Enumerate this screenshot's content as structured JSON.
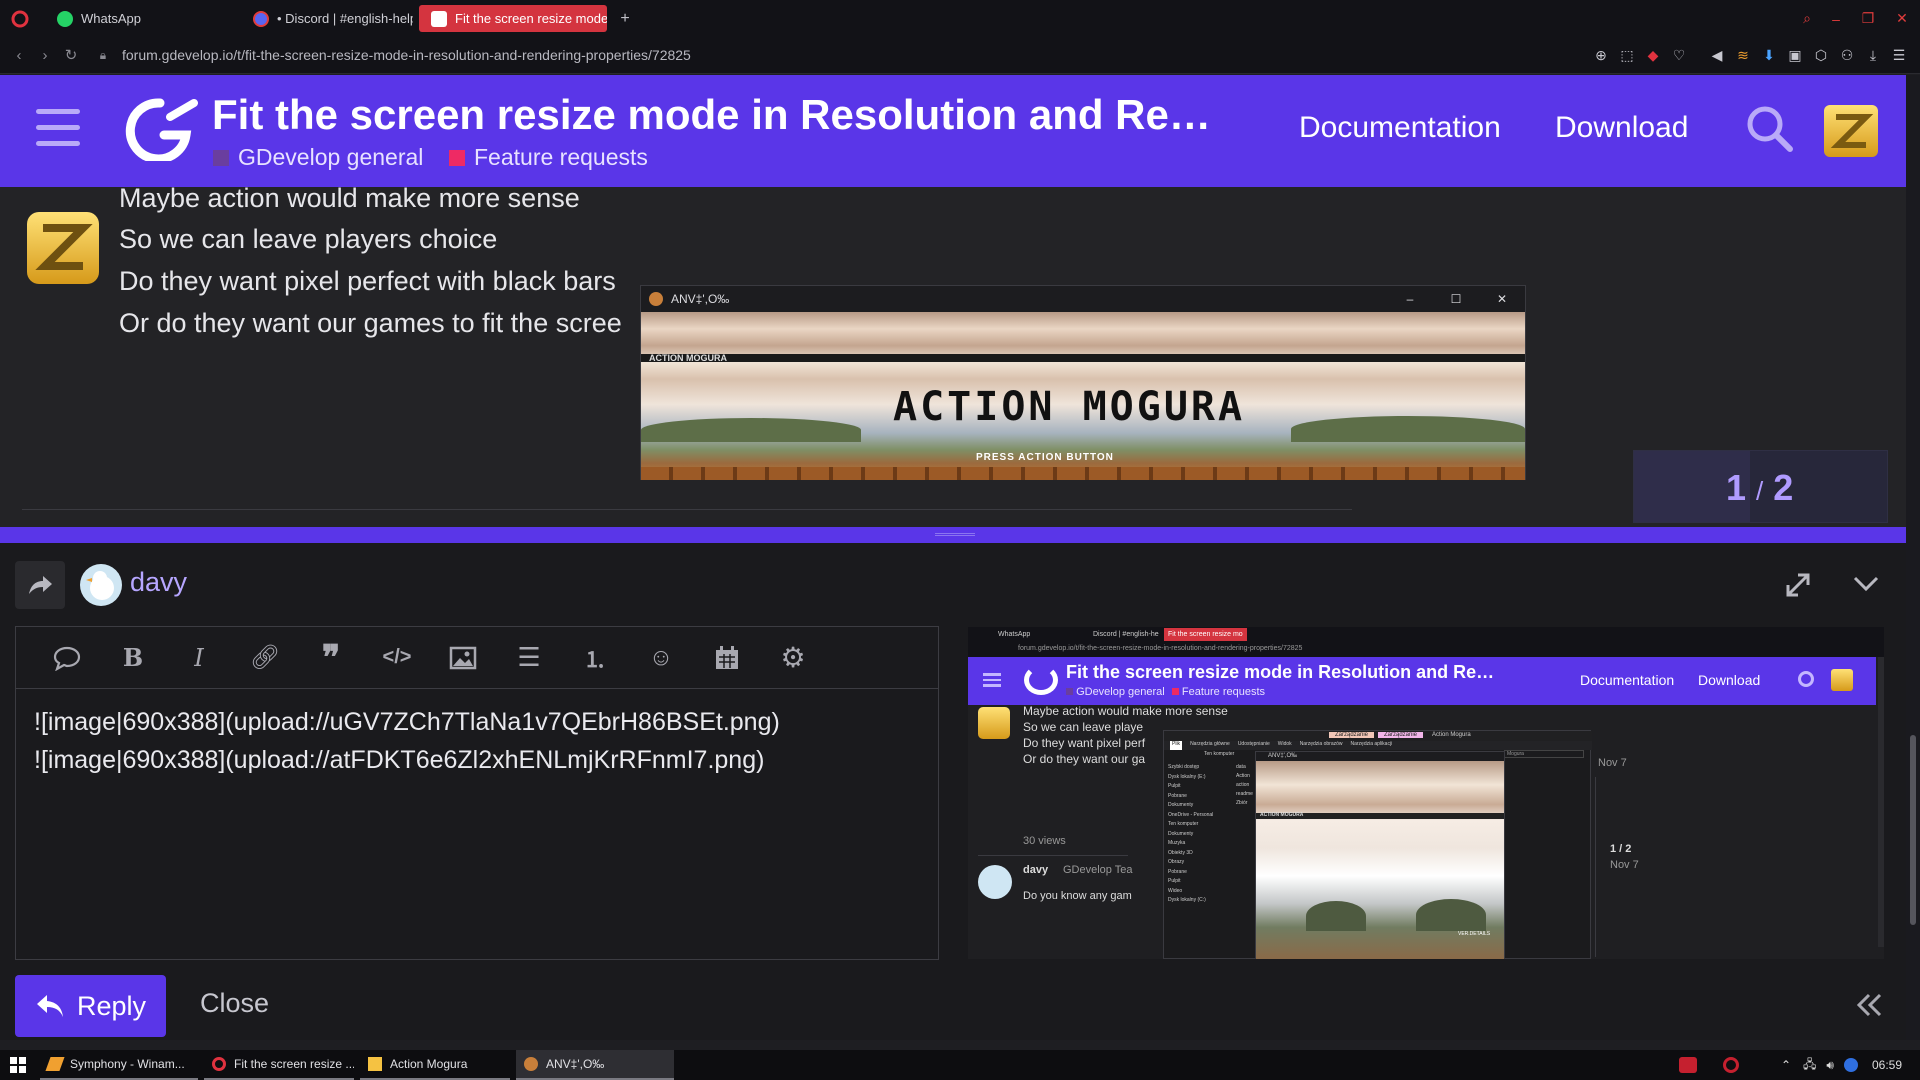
{
  "browser": {
    "tabs": [
      {
        "label": "WhatsApp",
        "active": false
      },
      {
        "label": "• Discord | #english-help",
        "active": false
      },
      {
        "label": "Fit the screen resize mode",
        "active": true
      }
    ],
    "new_tab": "+",
    "url": "forum.gdevelop.io/t/fit-the-screen-resize-mode-in-resolution-and-rendering-properties/72825"
  },
  "site": {
    "topic_title": "Fit the screen resize mode in Resolution and Re…",
    "categories": [
      {
        "label": "GDevelop general",
        "color": "#6a3e9f"
      },
      {
        "label": "Feature requests",
        "color": "#ee2a64"
      }
    ],
    "nav": {
      "documentation": "Documentation",
      "download": "Download"
    }
  },
  "post": {
    "lines": [
      "Maybe action would make more sense",
      "So we can leave players choice",
      "Do they want pixel perfect with black bars",
      "Or do they want our games to fit the scree"
    ]
  },
  "popup": {
    "title": "ANV‡',O‰",
    "game_title": "ACTION MOGURA",
    "game_subtitle": "ACTION MOGURA",
    "press_text": "PRESS ACTION BUTTON"
  },
  "pager": {
    "current": "1",
    "sep": "/",
    "total": "2"
  },
  "composer": {
    "username": "davy",
    "lines": [
      "![image|690x388](upload://uGV7ZCh7TlaNa1v7QEbrH86BSEt.png)",
      "![image|690x388](upload://atFDKT6e6Zl2xhENLmjKrRFnmI7.png)"
    ],
    "reply_label": "Reply",
    "close_label": "Close"
  },
  "preview": {
    "tabs": [
      "WhatsApp",
      "Discord | #english-he",
      "Fit the screen resize mo"
    ],
    "url": "forum.gdevelop.io/t/fit-the-screen-resize-mode-in-resolution-and-rendering-properties/72825",
    "topic_title": "Fit the screen resize mode in Resolution and Re…",
    "categories": [
      "GDevelop general",
      "Feature requests"
    ],
    "nav": {
      "documentation": "Documentation",
      "download": "Download"
    },
    "post_lines": [
      "Maybe action would make more sense",
      "So we can leave playe",
      "Do they want pixel perf",
      "Or do they want our ga"
    ],
    "views": "30 views",
    "reply_user": "davy",
    "reply_role": "GDevelop Tea",
    "reply_text": "Do you know any gam",
    "date1": "Nov 7",
    "pager": "1 / 2",
    "date2": "Nov 7",
    "explorer": {
      "menu_tabs": [
        "Zarządzanie",
        "Zarządzanie",
        "Action Mogura"
      ],
      "ribbon": [
        "Plik",
        "Narzędzia główne",
        "Udostępnianie",
        "Widok",
        "Narzędzia obrazów",
        "Narzędzia aplikacji"
      ],
      "sidebar": [
        "Szybki dostęp",
        "Dysk lokalny (E:)",
        "Pulpit",
        "Pobrane",
        "Dokumenty",
        "OneDrive - Personal",
        "Ten komputer",
        "Dokumenty",
        "Muzyka",
        "Obiekty 3D",
        "Obrazy",
        "Pobrane",
        "Pulpit",
        "Wideo",
        "Dysk lokalny (C:)"
      ],
      "files": [
        "data",
        "Action",
        "action",
        "readme",
        "Zbiór"
      ],
      "address": "Ten komputer",
      "search": "Mogura",
      "inner_title": "ANV‡',O‰",
      "game_label": "ACTION MOGURA",
      "game_corner": "VER.DETAILS"
    }
  },
  "taskbar": {
    "items": [
      {
        "label": "Symphony - Winam..."
      },
      {
        "label": "Fit the screen resize ..."
      },
      {
        "label": "Action Mogura"
      },
      {
        "label": "ANV‡',O‰"
      }
    ],
    "clock": "06:59"
  },
  "colors": {
    "brand": "#5a36e8",
    "tab_active": "#d4343f",
    "category_general": "#6a3e9f",
    "category_feature": "#ee2a64",
    "username": "#b6a6ff",
    "pager_text": "#b09bff"
  },
  "icons": [
    "whatsapp-icon",
    "discord-icon",
    "gdevelop-icon",
    "back-icon",
    "forward-icon",
    "reload-icon",
    "lock-icon",
    "zoom-icon",
    "snapshot-icon",
    "pocket-icon",
    "heart-icon",
    "speaker-icon",
    "rss-icon",
    "download-icon",
    "extensions-icon",
    "account-icon",
    "menu-icon",
    "search-icon",
    "share-arrow-icon",
    "expand-icon",
    "chevron-down-icon",
    "double-chevron-left-icon",
    "windows-icon"
  ]
}
